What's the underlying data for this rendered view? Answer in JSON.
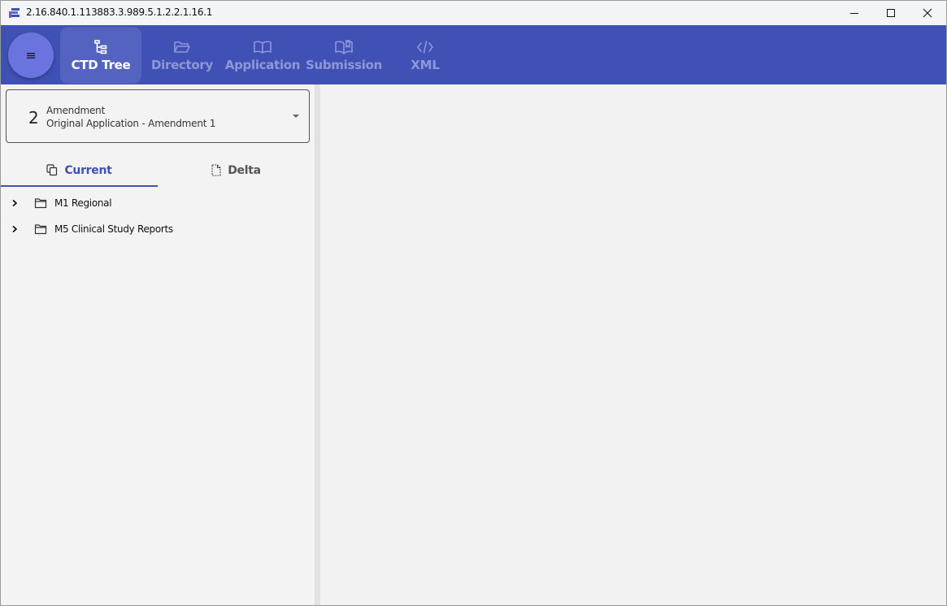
{
  "window": {
    "title": "2.16.840.1.113883.3.989.5.1.2.2.1.16.1",
    "icons": {
      "minimize": "minimize-icon",
      "maximize": "maximize-icon",
      "close": "close-icon"
    }
  },
  "appbar": {
    "menu_icon": "menu-icon",
    "nav": [
      {
        "label": "CTD Tree",
        "icon": "tree-icon",
        "active": true
      },
      {
        "label": "Directory",
        "icon": "folder-open-icon",
        "active": false
      },
      {
        "label": "Application",
        "icon": "book-icon",
        "active": false
      },
      {
        "label": "Submission",
        "icon": "book-open-icon",
        "active": false
      },
      {
        "label": "XML",
        "icon": "code-icon",
        "active": false
      }
    ],
    "colors": {
      "background": "#3f51b5",
      "active_tab": "#5463c0",
      "fab": "#6b74de"
    }
  },
  "sequence_selector": {
    "number": "2",
    "type": "Amendment",
    "description": "Original Application - Amendment 1"
  },
  "tabs": [
    {
      "label": "Current",
      "icon": "copy-icon",
      "active": true
    },
    {
      "label": "Delta",
      "icon": "file-diff-icon",
      "active": false
    }
  ],
  "tree": {
    "items": [
      {
        "label": "M1 Regional",
        "icon": "folder-icon"
      },
      {
        "label": "M5 Clinical Study Reports",
        "icon": "folder-icon"
      }
    ]
  }
}
